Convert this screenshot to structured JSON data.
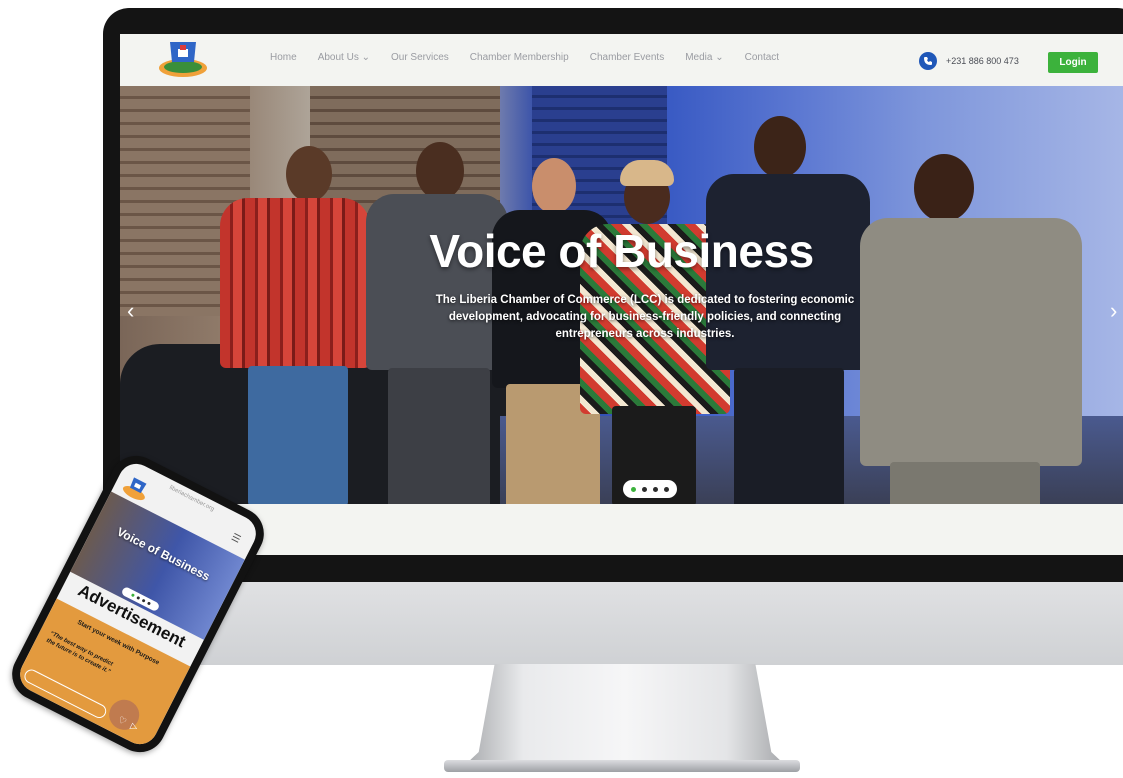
{
  "nav": {
    "links": [
      "Home",
      "About Us ⌄",
      "Our Services",
      "Chamber Membership",
      "Chamber Events",
      "Media ⌄",
      "Contact"
    ],
    "phone": "+231 886 800 473",
    "login_label": "Login"
  },
  "hero": {
    "title": "Voice of Business",
    "subtitle": "The Liberia Chamber of Commerce (LCC) is dedicated to fostering economic development, advocating for business-friendly policies, and connecting entrepreneurs across industries.",
    "prev_arrow": "‹",
    "next_arrow": "›",
    "slide_count": 4,
    "active_slide": 1
  },
  "phone": {
    "url": "liberiachamber.org",
    "menu_icon": "☰",
    "hero_title": "Voice of Business",
    "advert_heading": "Advertisement",
    "card_heading": "Start your week with Purpose",
    "card_quote": "“The best way to predict the future is to create it.”",
    "heart_icon": "♡",
    "send_icon": "▷"
  },
  "colors": {
    "login_green": "#3cb23c",
    "phone_icon_blue": "#1f57b8",
    "advert_orange": "#e39a3e"
  }
}
